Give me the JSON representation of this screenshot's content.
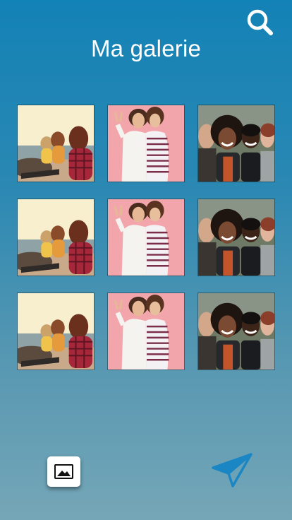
{
  "header": {
    "title": "Ma galerie",
    "search_icon": "search-icon"
  },
  "gallery": {
    "photos": [
      {
        "subject": "beach-friends-photo"
      },
      {
        "subject": "two-women-pink-photo"
      },
      {
        "subject": "group-selfie-photo"
      },
      {
        "subject": "beach-friends-photo"
      },
      {
        "subject": "two-women-pink-photo"
      },
      {
        "subject": "group-selfie-photo"
      },
      {
        "subject": "beach-friends-photo"
      },
      {
        "subject": "two-women-pink-photo"
      },
      {
        "subject": "group-selfie-photo"
      }
    ]
  },
  "bottom_bar": {
    "gallery_icon": "image-icon",
    "send_icon": "paper-plane-icon"
  },
  "colors": {
    "background_top": "#1382b6",
    "background_bottom": "#75a6b7",
    "title": "#ffffff",
    "send_icon": "#1a86c4"
  }
}
